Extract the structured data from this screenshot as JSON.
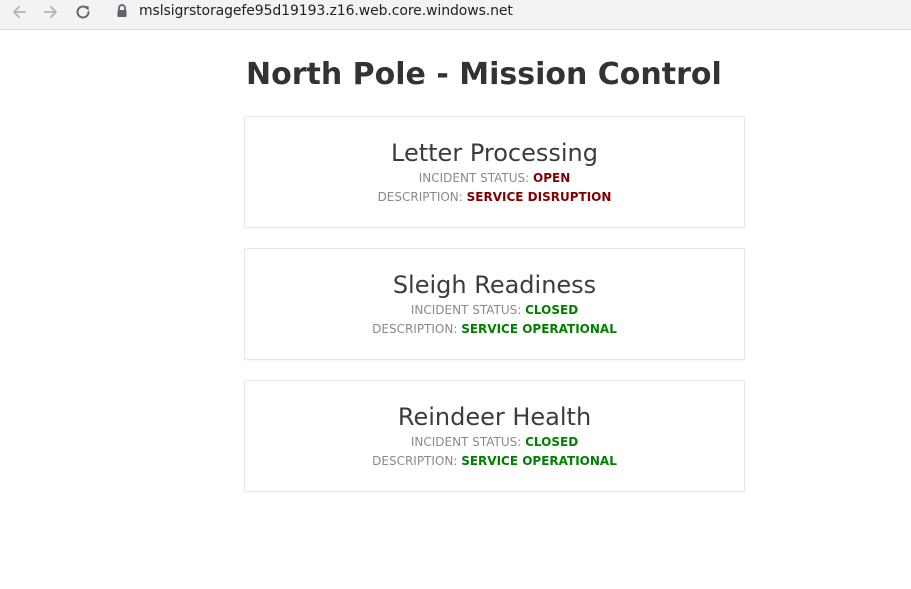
{
  "browser": {
    "url": "mslsigrstoragefe95d19193.z16.web.core.windows.net",
    "icons": [
      "back-arrow-icon",
      "forward-arrow-icon",
      "reload-icon",
      "lock-icon"
    ]
  },
  "page": {
    "title": "North Pole - Mission Control",
    "status_label": "INCIDENT STATUS:",
    "description_label": "DESCRIPTION:"
  },
  "services": [
    {
      "name": "Letter Processing",
      "status": "OPEN",
      "description": "SERVICE DISRUPTION",
      "color": "#800000"
    },
    {
      "name": "Sleigh Readiness",
      "status": "CLOSED",
      "description": "SERVICE OPERATIONAL",
      "color": "#008000"
    },
    {
      "name": "Reindeer Health",
      "status": "CLOSED",
      "description": "SERVICE OPERATIONAL",
      "color": "#008000"
    }
  ]
}
